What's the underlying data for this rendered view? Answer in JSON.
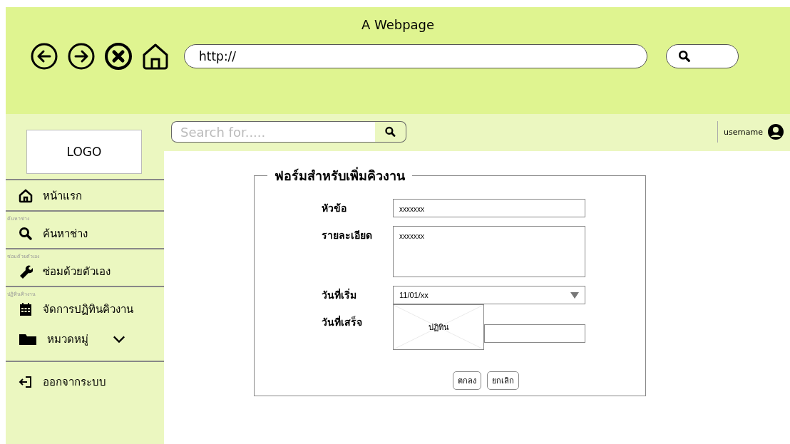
{
  "browser": {
    "title": "A Webpage",
    "url": "http://"
  },
  "header": {
    "search": {
      "placeholder": "Search for....."
    },
    "username": "username"
  },
  "logo": "LOGO",
  "sidebar": {
    "items": [
      {
        "kind": "link",
        "label": "หน้าแรก"
      },
      {
        "kind": "link",
        "caption": "ค้นหาช่าง",
        "label": "ค้นหาช่าง"
      },
      {
        "kind": "link",
        "caption": "ซ่อมด้วยตัวเอง",
        "label": "ซ่อมด้วยตัวเอง"
      },
      {
        "kind": "link",
        "caption": "ปฏิทินคิวงาน",
        "label": "จัดการปฏิทินคิวงาน"
      },
      {
        "kind": "group",
        "label": "หมวดหมู่"
      },
      {
        "kind": "logout",
        "label": "ออกจากระบบ"
      }
    ]
  },
  "form": {
    "title": "ฟอร์มสำหรับเพิ่มคิวงาน",
    "fields": [
      {
        "kind": "text",
        "label": "หัวข้อ",
        "value": "xxxxxxx"
      },
      {
        "kind": "textarea",
        "label": "รายละเอียด",
        "value": "xxxxxxx"
      },
      {
        "kind": "dropdown",
        "label": "วันที่เริ่ม",
        "value": "11/01/xx"
      },
      {
        "kind": "calendar",
        "label": "วันที่เสร็จ",
        "popup": "ปฏิทิน"
      }
    ],
    "buttons": [
      "ตกลง",
      "ยกเลิก"
    ]
  }
}
